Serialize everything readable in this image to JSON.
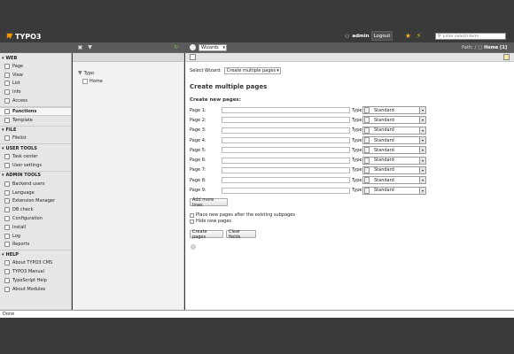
{
  "app": {
    "logo_text": "TYPO3",
    "user": "admin",
    "logout": "Logout",
    "search_placeholder": "Enter search term"
  },
  "toolbar": {
    "wizards_select": "Wizards",
    "path_label": "Path:",
    "path_sep": "/",
    "path_page": "Home [1]"
  },
  "modules": [
    {
      "title": "WEB",
      "items": [
        "Page",
        "View",
        "List",
        "Info",
        "Access"
      ]
    },
    {
      "title": "",
      "items": [
        "Functions",
        "Template"
      ]
    },
    {
      "title": "FILE",
      "items": [
        "Filelist"
      ]
    },
    {
      "title": "USER TOOLS",
      "items": [
        "Task center",
        "User settings"
      ]
    },
    {
      "title": "ADMIN TOOLS",
      "items": [
        "Backend users",
        "Language",
        "Extension Manager",
        "DB check",
        "Configuration",
        "Install",
        "Log",
        "Reports"
      ]
    },
    {
      "title": "HELP",
      "items": [
        "About TYPO3 CMS",
        "TYPO3 Manual",
        "TypoScript Help",
        "About Modules"
      ]
    }
  ],
  "active_module": "Functions",
  "tree": {
    "root": "Typo",
    "child": "Home"
  },
  "content": {
    "select_wizard_label": "Select Wizard:",
    "select_wizard_value": "Create multiple pages",
    "heading": "Create multiple pages",
    "subheading": "Create new pages:",
    "type_label": "Type:",
    "rows": [
      {
        "label": "Page 1:",
        "value": "",
        "type": "Standard"
      },
      {
        "label": "Page 2:",
        "value": "",
        "type": "Standard"
      },
      {
        "label": "Page 3:",
        "value": "",
        "type": "Standard"
      },
      {
        "label": "Page 4:",
        "value": "",
        "type": "Standard"
      },
      {
        "label": "Page 5:",
        "value": "",
        "type": "Standard"
      },
      {
        "label": "Page 6:",
        "value": "",
        "type": "Standard"
      },
      {
        "label": "Page 7:",
        "value": "",
        "type": "Standard"
      },
      {
        "label": "Page 8:",
        "value": "",
        "type": "Standard"
      },
      {
        "label": "Page 9:",
        "value": "",
        "type": "Standard"
      }
    ],
    "add_more": "Add more lines",
    "opt_after": "Place new pages after the existing subpages",
    "opt_hide": "Hide new pages",
    "create_btn": "Create pages",
    "clear_btn": "Clear fields"
  },
  "status": "Done",
  "colors": {
    "accent": "#f49700",
    "topbar": "#3a3a3a"
  }
}
